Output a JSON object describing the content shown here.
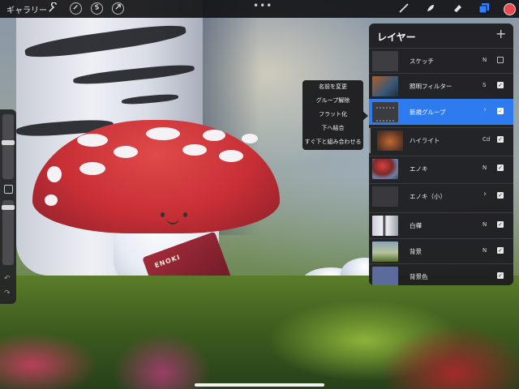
{
  "toolbar": {
    "gallery_label": "ギャラリー",
    "tools_left": [
      "wrench-icon",
      "magic-wand-icon",
      "selection-icon",
      "transform-arrow-icon"
    ],
    "more_label": "•••",
    "tools_right": [
      "brush-icon",
      "smudge-icon",
      "eraser-icon",
      "layers-icon"
    ],
    "active_tool": "layers-icon",
    "current_color": "#e84a4f"
  },
  "artwork": {
    "book_title": "ENOKI"
  },
  "context_menu": {
    "items": [
      "名前を変更",
      "グループ解除",
      "フラット化",
      "下へ結合",
      "すぐ下と組み合わせる"
    ]
  },
  "layers_panel": {
    "title": "レイヤー",
    "add_label": "+",
    "accent": "#2e7bf0",
    "layers": [
      {
        "name": "スケッチ",
        "mode": "N",
        "visible": false,
        "thumb": "sketch"
      },
      {
        "name": "照明フィルター",
        "mode": "S",
        "visible": true,
        "thumb": "photo"
      },
      {
        "name": "新規グループ",
        "mode": "",
        "visible": true,
        "thumb": "group",
        "selected": true,
        "is_group": true
      },
      {
        "name": "ハイライト",
        "mode": "Cd",
        "visible": true,
        "thumb": "highlight"
      },
      {
        "name": "エノキ",
        "mode": "N",
        "visible": true,
        "thumb": "enoki"
      },
      {
        "name": "エノキ（小）",
        "mode": "",
        "visible": true,
        "thumb": "enoki-small",
        "is_group": true
      },
      {
        "name": "白樺",
        "mode": "N",
        "visible": true,
        "thumb": "birch"
      },
      {
        "name": "背景",
        "mode": "N",
        "visible": true,
        "thumb": "bg"
      },
      {
        "name": "背景色",
        "mode": "",
        "visible": true,
        "thumb": "bgcolor"
      }
    ]
  }
}
